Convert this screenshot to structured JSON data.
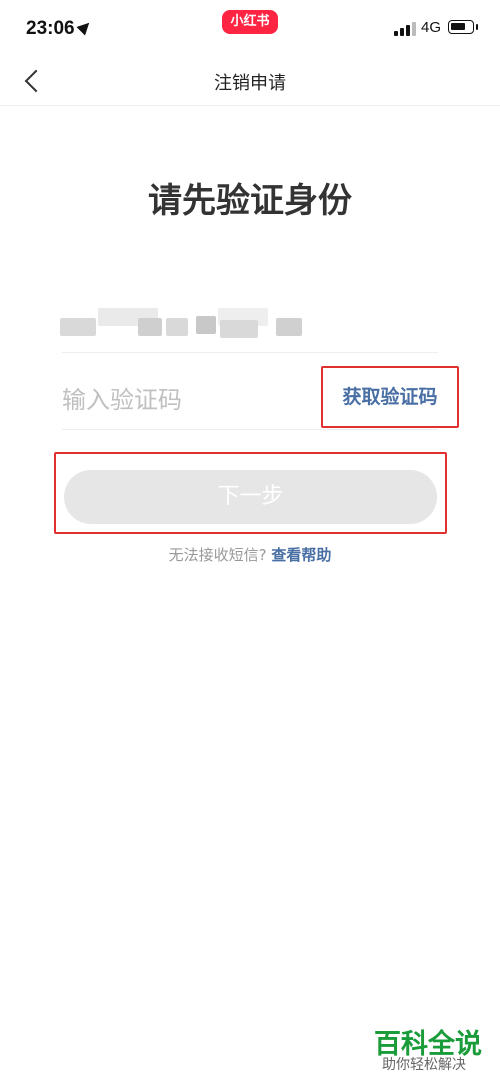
{
  "status_bar": {
    "time": "23:06",
    "app_badge": "小红书",
    "network": "4G"
  },
  "nav": {
    "title": "注销申请"
  },
  "main": {
    "heading": "请先验证身份",
    "code_placeholder": "输入验证码",
    "get_code_label": "获取验证码",
    "next_label": "下一步",
    "help_prefix": "无法接收短信?",
    "help_link": "查看帮助"
  },
  "watermark": {
    "title": "百科全说",
    "subtitle": "助你轻松解决"
  },
  "colors": {
    "accent_link": "#4a6fa5",
    "highlight_box": "#e03030",
    "brand_red": "#ff2442",
    "watermark_green": "#1a9c3a"
  },
  "icons": [
    "location-arrow-icon",
    "signal-icon",
    "battery-icon",
    "back-chevron-icon"
  ]
}
